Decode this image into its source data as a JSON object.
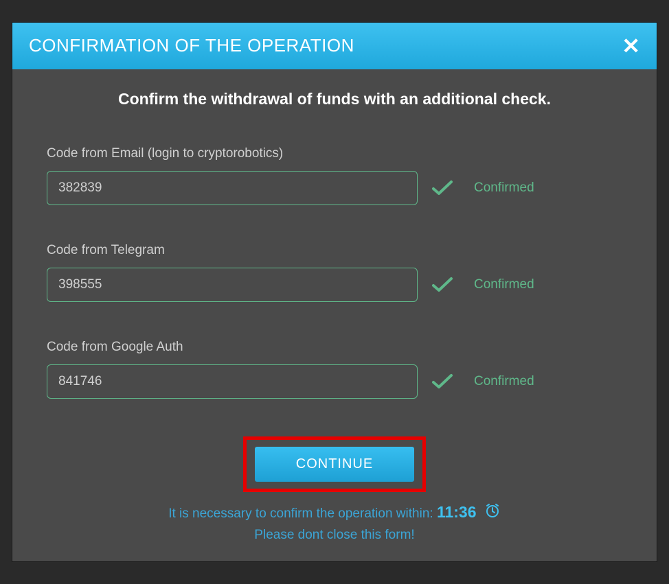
{
  "header": {
    "title": "CONFIRMATION OF THE OPERATION"
  },
  "subtitle": "Confirm the withdrawal of funds with an additional check.",
  "fields": [
    {
      "label": "Code from Email (login to cryptorobotics)",
      "value": "382839",
      "status": "Confirmed"
    },
    {
      "label": "Code from Telegram",
      "value": "398555",
      "status": "Confirmed"
    },
    {
      "label": "Code from Google Auth",
      "value": "841746",
      "status": "Confirmed"
    }
  ],
  "button": {
    "continue": "CONTINUE"
  },
  "footer": {
    "line1_prefix": "It is necessary to confirm the operation within: ",
    "timer": "11:36",
    "line2": "Please dont close this form!"
  },
  "colors": {
    "accent": "#3ec1f0",
    "success": "#5fb88a",
    "highlight": "#e60000"
  }
}
